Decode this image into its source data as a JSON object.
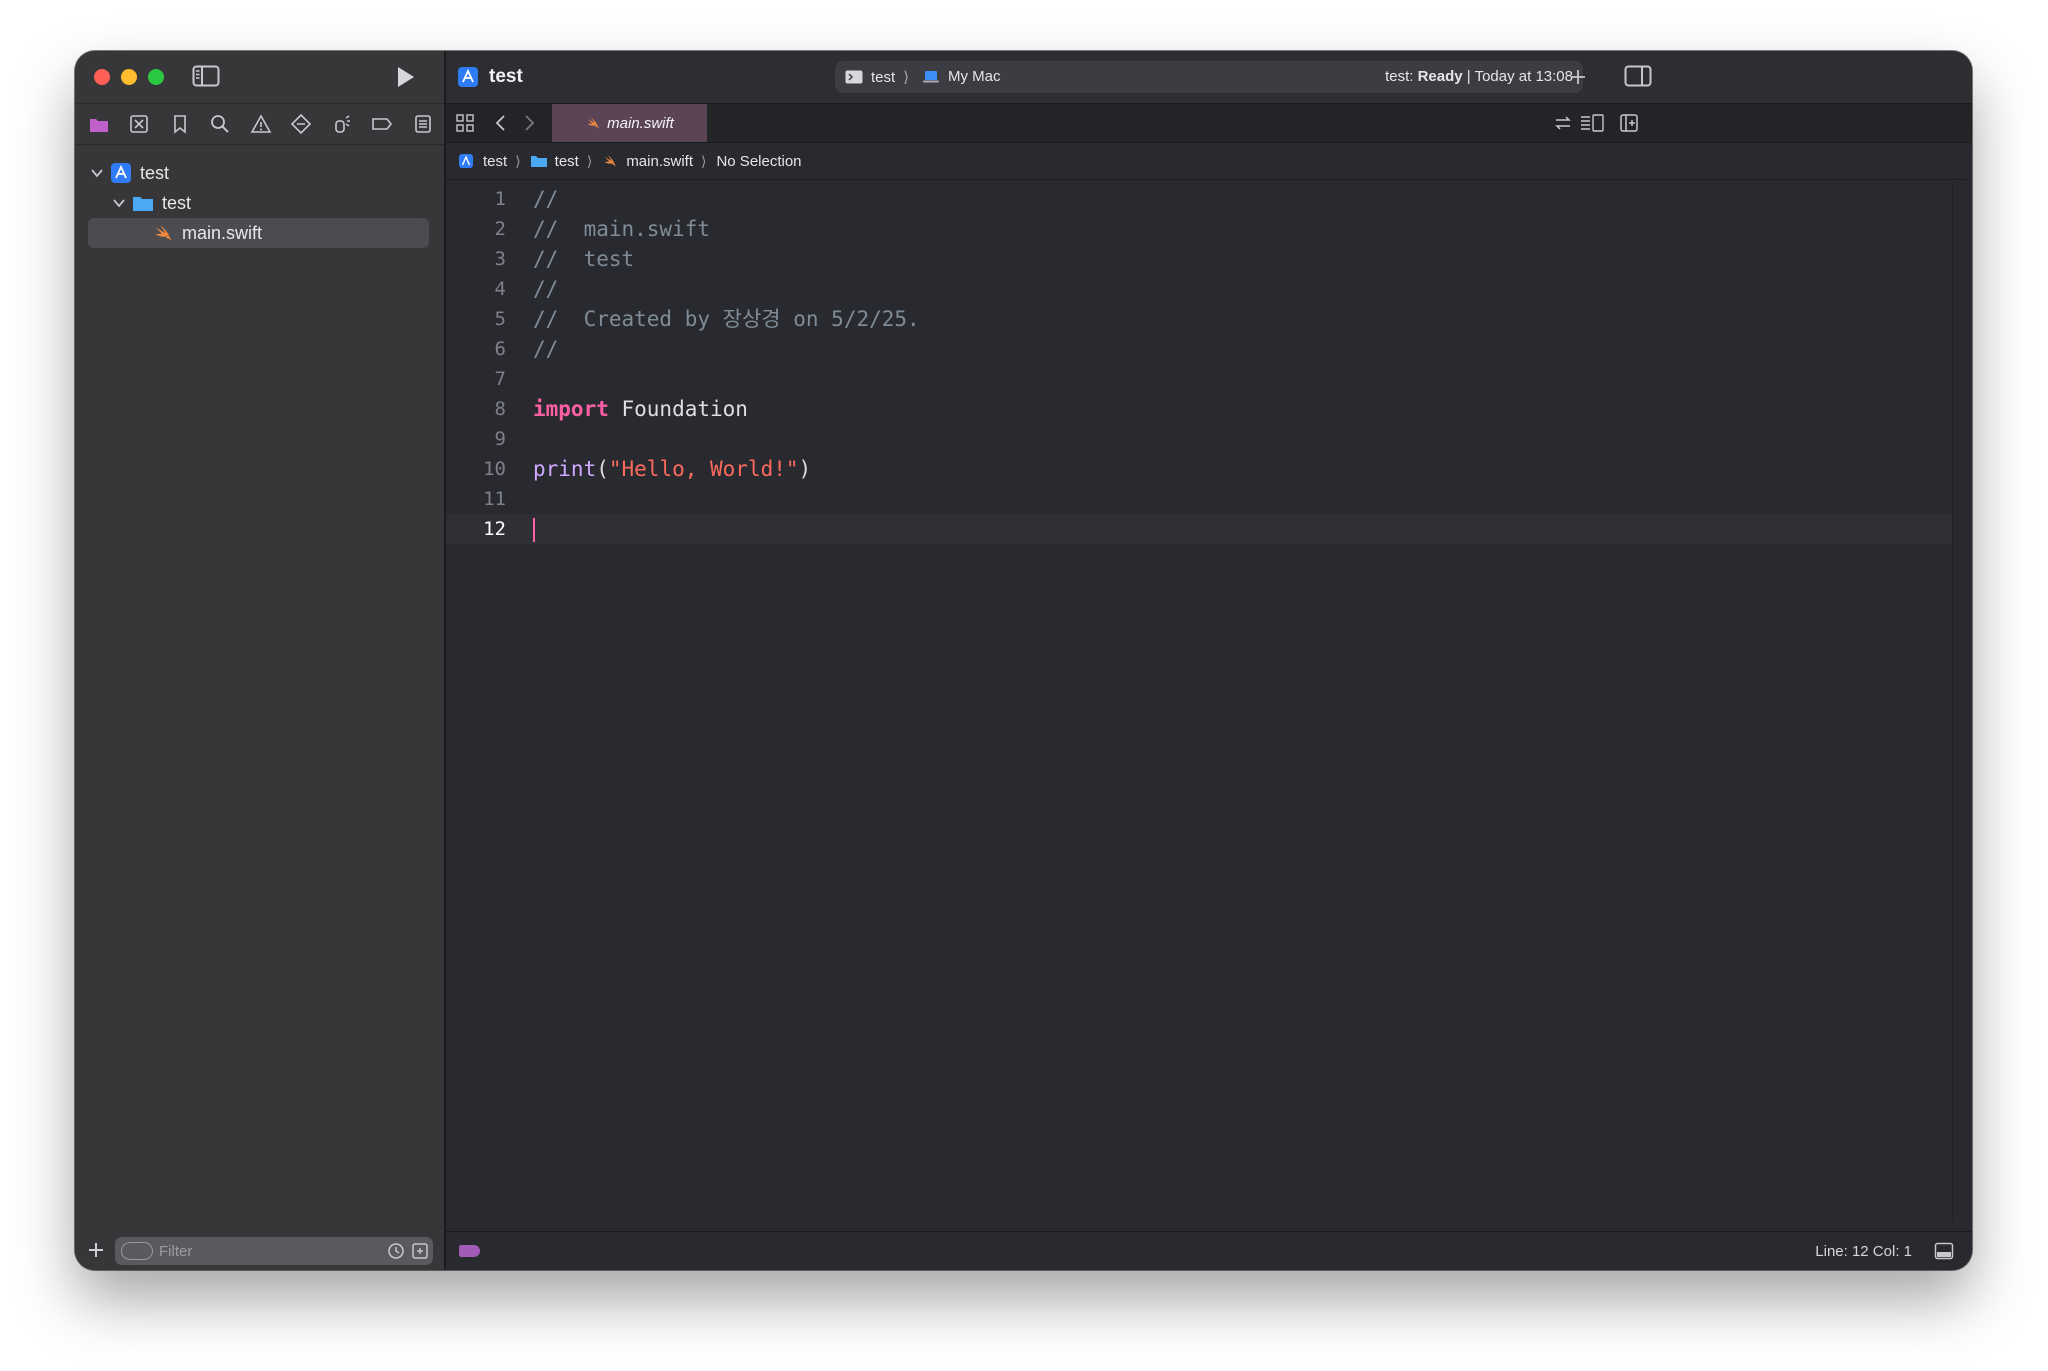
{
  "window": {
    "project_name": "test",
    "accent": "#fc5fa3"
  },
  "activity": {
    "scheme": "test",
    "destination": "My Mac",
    "status_prefix": "test: ",
    "status_state": "Ready",
    "status_suffix": " | Today at 13:08"
  },
  "navigator": {
    "tabs": [
      "project-navigator-icon",
      "source-control-icon",
      "bookmark-icon",
      "find-icon",
      "issue-icon",
      "test-icon",
      "debug-icon",
      "breakpoint-icon",
      "report-icon"
    ],
    "tree": [
      {
        "label": "test",
        "kind": "project",
        "depth": 0
      },
      {
        "label": "test",
        "kind": "folder",
        "depth": 1
      },
      {
        "label": "main.swift",
        "kind": "swift-file",
        "depth": 2,
        "selected": true
      }
    ],
    "filter_placeholder": "Filter"
  },
  "editor": {
    "tab_label": "main.swift",
    "breadcrumb": [
      "test",
      "test",
      "main.swift",
      "No Selection"
    ],
    "lines": [
      {
        "n": "1",
        "code": "//"
      },
      {
        "n": "2",
        "code": "//  main.swift"
      },
      {
        "n": "3",
        "code": "//  test"
      },
      {
        "n": "4",
        "code": "//"
      },
      {
        "n": "5",
        "code": "//  Created by 장상경 on 5/2/25."
      },
      {
        "n": "6",
        "code": "//"
      },
      {
        "n": "7",
        "code": ""
      },
      {
        "n": "8",
        "kw": "import",
        "rest": " Foundation"
      },
      {
        "n": "9",
        "code": ""
      },
      {
        "n": "10",
        "fn": "print",
        "open": "(",
        "str": "\"Hello, World!\"",
        "close": ")"
      },
      {
        "n": "11",
        "code": ""
      },
      {
        "n": "12",
        "code": ""
      }
    ]
  },
  "statusbar": {
    "line_col": "Line: 12  Col: 1"
  }
}
